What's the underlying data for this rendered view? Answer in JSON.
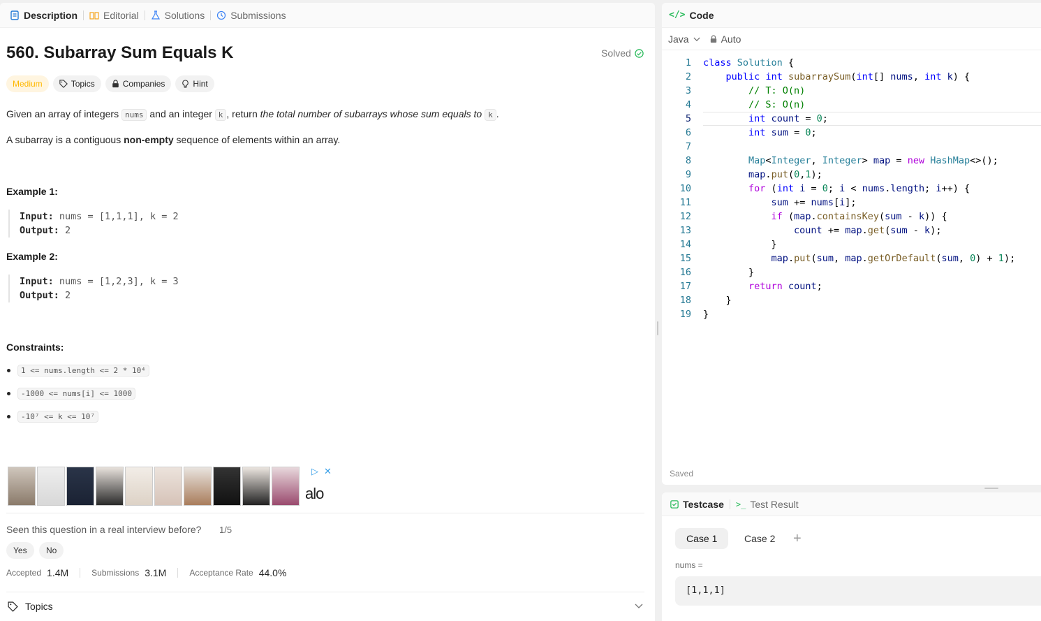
{
  "left_tabs": [
    {
      "label": "Description"
    },
    {
      "label": "Editorial"
    },
    {
      "label": "Solutions"
    },
    {
      "label": "Submissions"
    }
  ],
  "problem": {
    "title": "560. Subarray Sum Equals K",
    "status": "Solved",
    "difficulty": "Medium",
    "chips": [
      "Topics",
      "Companies",
      "Hint"
    ],
    "desc1_a": "Given an array of integers ",
    "desc1_code1": "nums",
    "desc1_b": " and an integer ",
    "desc1_code2": "k",
    "desc1_c": ", return ",
    "desc1_em": "the total number of subarrays whose sum equals to",
    "desc1_code3": "k",
    "desc1_d": ".",
    "desc2_a": "A subarray is a contiguous ",
    "desc2_b": "non-empty",
    "desc2_c": " sequence of elements within an array.",
    "example1_title": "Example 1:",
    "example1_input_label": "Input:",
    "example1_input": "nums = [1,1,1], k = 2",
    "example1_output_label": "Output:",
    "example1_output": "2",
    "example2_title": "Example 2:",
    "example2_input_label": "Input:",
    "example2_input": "nums = [1,2,3], k = 3",
    "example2_output_label": "Output:",
    "example2_output": "2",
    "constraints_title": "Constraints:",
    "constraints": [
      "1 <= nums.length <= 2 * 10⁴",
      "-1000 <= nums[i] <= 1000",
      "-10⁷ <= k <= 10⁷"
    ]
  },
  "ad": {
    "logo": "alo"
  },
  "feedback": {
    "question": "Seen this question in a real interview before?",
    "count": "1/5",
    "yes": "Yes",
    "no": "No"
  },
  "stats": {
    "accepted_label": "Accepted",
    "accepted": "1.4M",
    "submissions_label": "Submissions",
    "submissions": "3.1M",
    "rate_label": "Acceptance Rate",
    "rate": "44.0%"
  },
  "topics_section": "Topics",
  "editor": {
    "header": "Code",
    "language": "Java",
    "mode": "Auto",
    "saved": "Saved",
    "line_numbers": [
      "1",
      "2",
      "3",
      "4",
      "5",
      "6",
      "7",
      "8",
      "9",
      "10",
      "11",
      "12",
      "13",
      "14",
      "15",
      "16",
      "17",
      "18",
      "19"
    ]
  },
  "testcase": {
    "tab1": "Testcase",
    "tab2": "Test Result",
    "case1": "Case 1",
    "case2": "Case 2",
    "add": "+",
    "var_label": "nums =",
    "var_value": "[1,1,1]"
  },
  "colors": {
    "medium": "#ffb800",
    "solved_check": "#2cbb5d",
    "code_icon": "#2cbb5d"
  }
}
